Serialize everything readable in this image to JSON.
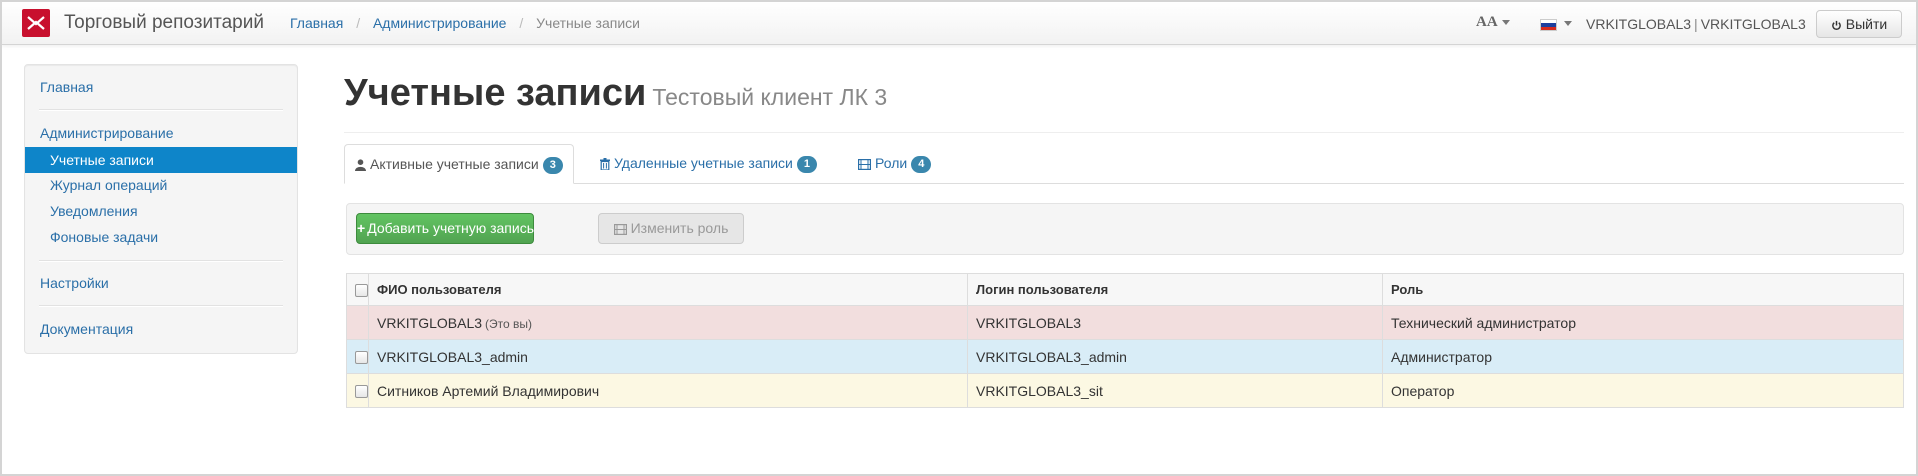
{
  "app": {
    "title": "Торговый репозитарий"
  },
  "colors": {
    "brand": "#c8102e",
    "link": "#2a6fa8",
    "active": "#0e85c9",
    "add_button": "#5bb75b",
    "badge": "#3a87ad"
  },
  "breadcrumb": [
    {
      "label": "Главная"
    },
    {
      "label": "Администрирование"
    },
    {
      "label": "Учетные записи"
    }
  ],
  "header": {
    "font_size_label": "AA",
    "user": "VRKITGLOBAL3",
    "org": "VRKITGLOBAL3",
    "logout_label": "Выйти"
  },
  "sidebar": {
    "home": "Главная",
    "admin": "Администрирование",
    "admin_items": [
      "Учетные записи",
      "Журнал операций",
      "Уведомления",
      "Фоновые задачи"
    ],
    "settings": "Настройки",
    "docs": "Документация"
  },
  "page": {
    "title": "Учетные записи",
    "subtitle": "Тестовый клиент ЛК 3"
  },
  "tabs": [
    {
      "label": "Активные учетные записи",
      "count": "3",
      "icon": "user-icon"
    },
    {
      "label": "Удаленные учетные записи",
      "count": "1",
      "icon": "trash-icon"
    },
    {
      "label": "Роли",
      "count": "4",
      "icon": "film-icon"
    }
  ],
  "toolbar": {
    "add_label": "Добавить учетную запись",
    "change_role_label": "Изменить роль"
  },
  "table": {
    "columns": [
      "ФИО пользователя",
      "Логин пользователя",
      "Роль"
    ],
    "rows": [
      {
        "name": "VRKITGLOBAL3",
        "note": "(Это вы)",
        "login": "VRKITGLOBAL3",
        "role": "Технический администратор"
      },
      {
        "name": "VRKITGLOBAL3_admin",
        "login": "VRKITGLOBAL3_admin",
        "role": "Администратор"
      },
      {
        "name": "Ситников Артемий Владимирович",
        "login": "VRKITGLOBAL3_sit",
        "role": "Оператор"
      }
    ]
  }
}
